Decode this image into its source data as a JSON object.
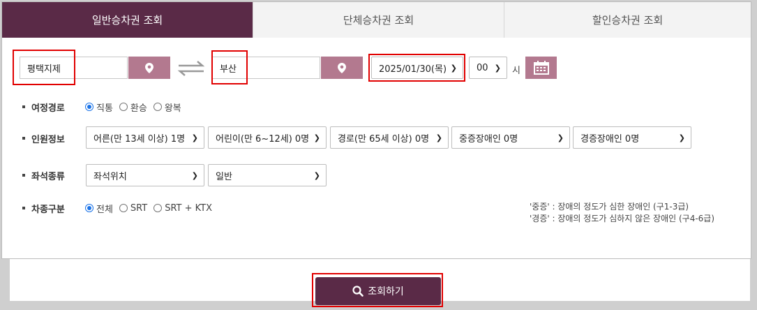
{
  "tabs": [
    "일반승차권 조회",
    "단체승차권 조회",
    "할인승차권 조회"
  ],
  "departure": {
    "value": "평택지제"
  },
  "arrival": {
    "value": "부산"
  },
  "date": {
    "value": "2025/01/30(목)"
  },
  "hour": {
    "value": "00",
    "unit": "시"
  },
  "route": {
    "label": "여정경로",
    "options": [
      "직통",
      "환승",
      "왕복"
    ],
    "selected": "직통"
  },
  "passengers": {
    "label": "인원정보",
    "selects": [
      "어른(만 13세 이상) 1명",
      "어린이(만 6~12세) 0명",
      "경로(만 65세 이상) 0명",
      "중증장애인 0명",
      "경증장애인 0명"
    ]
  },
  "seat": {
    "label": "좌석종류",
    "selects": [
      "좌석위치",
      "일반"
    ]
  },
  "train_type": {
    "label": "차종구분",
    "options": [
      "전체",
      "SRT",
      "SRT + KTX"
    ],
    "selected": "전체"
  },
  "notes": [
    "'중증' : 장애의 정도가 심한 장애인 (구1-3급)",
    "'경증' : 장애의 정도가 심하지 않은 장애인 (구4-6급)"
  ],
  "search_button": "조회하기",
  "colors": {
    "brand": "#5a2a47",
    "pin": "#b3798f",
    "highlight": "#e10000",
    "radio": "#1a73e8"
  }
}
